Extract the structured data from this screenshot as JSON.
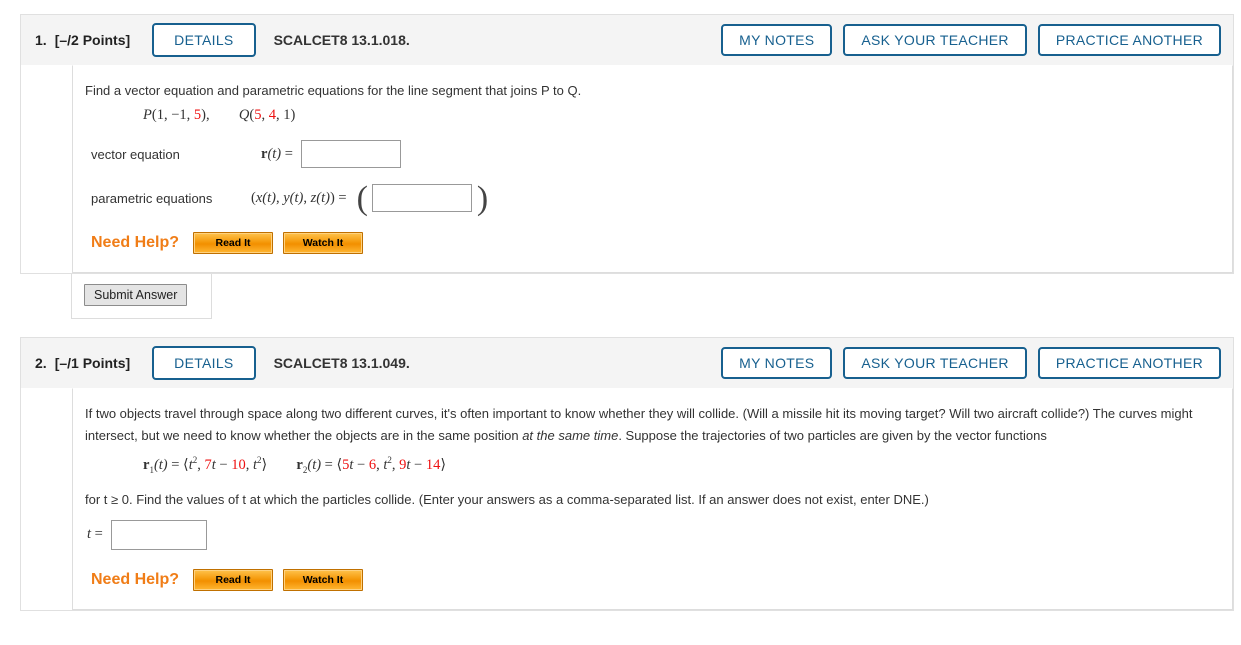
{
  "problems": [
    {
      "number": "1.",
      "points": "[–/2 Points]",
      "details_label": "DETAILS",
      "code": "SCALCET8 13.1.018.",
      "actions": [
        {
          "label": "MY NOTES",
          "name": "my-notes-button"
        },
        {
          "label": "ASK YOUR TEACHER",
          "name": "ask-your-teacher-button"
        },
        {
          "label": "PRACTICE ANOTHER",
          "name": "practice-another-button"
        }
      ],
      "prompt": "Find a vector equation and parametric equations for the line segment that joins P to Q.",
      "point_p": {
        "name": "P",
        "x": "1",
        "y": "−1",
        "z": "5"
      },
      "point_q": {
        "name": "Q",
        "x": "5",
        "y": "4",
        "z": "1"
      },
      "vector_row": {
        "label": "vector equation",
        "symbol": "r(t)  = ",
        "value": "",
        "placeholder": ""
      },
      "param_row": {
        "label": "parametric equations",
        "symbol": "(x(t), y(t), z(t))  = ",
        "value": "",
        "placeholder": ""
      },
      "need_help": {
        "label": "Need Help?",
        "read_it": "Read It",
        "watch_it": "Watch It"
      },
      "submit_label": "Submit Answer"
    },
    {
      "number": "2.",
      "points": "[–/1 Points]",
      "details_label": "DETAILS",
      "code": "SCALCET8 13.1.049.",
      "actions": [
        {
          "label": "MY NOTES",
          "name": "my-notes-button"
        },
        {
          "label": "ASK YOUR TEACHER",
          "name": "ask-your-teacher-button"
        },
        {
          "label": "PRACTICE ANOTHER",
          "name": "practice-another-button"
        }
      ],
      "paragraph_part1": "If two objects travel through space along two different curves, it's often important to know whether they will collide. (Will a missile hit its moving target? Will two aircraft collide?) The curves might intersect, but we need to know whether the objects are in the same position ",
      "paragraph_italic": "at the same time",
      "paragraph_part2": ". Suppose the trajectories of two particles are given by the vector functions",
      "r1": {
        "coef_t": "7",
        "const": "10"
      },
      "r2": {
        "coef_t": "5",
        "const": "6",
        "coef_t2": "9",
        "const2": "14"
      },
      "instruction": "for  t ≥ 0.  Find the values of t at which the particles collide. (Enter your answers as a comma-separated list. If an answer does not exist, enter DNE.)",
      "t_row": {
        "label": "t = ",
        "value": "",
        "placeholder": ""
      },
      "need_help": {
        "label": "Need Help?",
        "read_it": "Read It",
        "watch_it": "Watch It"
      }
    }
  ],
  "colors": {
    "accent_blue": "#17608f",
    "red_value": "#ee1111",
    "orange": "#f07d17",
    "header_bg": "#f4f4f4"
  }
}
